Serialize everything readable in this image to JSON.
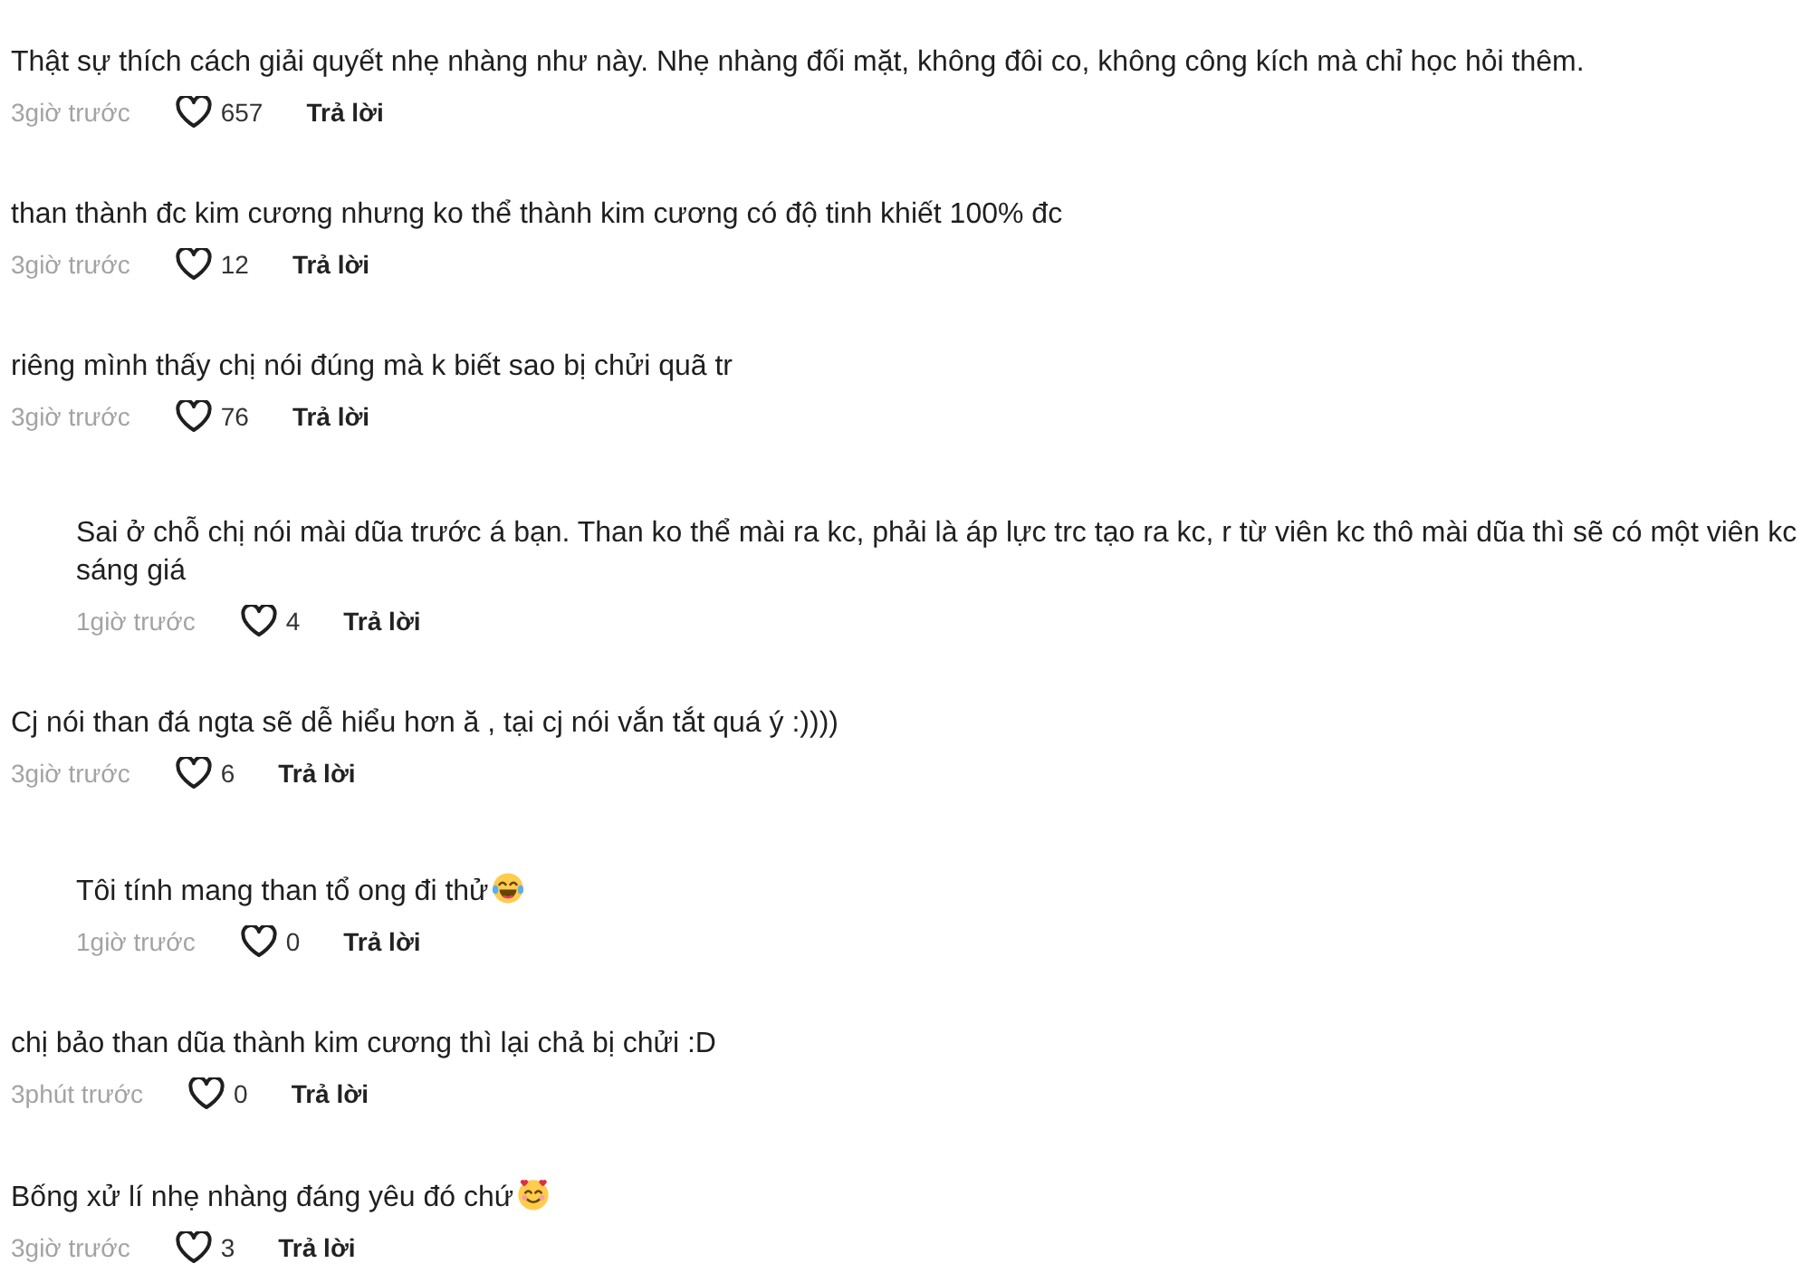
{
  "comments": [
    {
      "text": "Thật sự thích cách giải quyết nhẹ nhàng như này. Nhẹ nhàng đối mặt, không đôi co, không công kích mà chỉ học hỏi thêm.",
      "time": "3giờ trước",
      "likes": "657",
      "liked": false,
      "reply_label": "Trả lời"
    },
    {
      "text": "than thành đc kim cương nhưng ko thể thành kim cương có độ tinh khiết 100% đc",
      "time": "3giờ trước",
      "likes": "12",
      "liked": false,
      "reply_label": "Trả lời"
    },
    {
      "text": "riêng mình thấy chị nói đúng mà k biết sao bị chửi quã tr",
      "time": "3giờ trước",
      "likes": "76",
      "liked": false,
      "reply_label": "Trả lời",
      "replies": [
        {
          "text": "Sai ở chỗ chị nói mài dũa trước á bạn. Than ko thể mài ra kc, phải là áp lực trc tạo ra kc, r từ viên kc thô mài dũa thì sẽ có một viên kc sáng giá",
          "time": "1giờ trước",
          "likes": "4",
          "liked": false,
          "reply_label": "Trả lời"
        }
      ]
    },
    {
      "text": "Cj nói than đá ngta sẽ dễ hiểu hơn ă , tại cj nói vắn tắt quá ý :))))",
      "time": "3giờ trước",
      "likes": "6",
      "liked": false,
      "reply_label": "Trả lời",
      "replies": [
        {
          "text": "Tôi tính mang than tổ ong đi thử",
          "emoji": {
            "kind": "laughing"
          },
          "time": "1giờ trước",
          "likes": "0",
          "liked": false,
          "reply_label": "Trả lời"
        }
      ]
    },
    {
      "text": "chị bảo than dũa thành kim cương thì lại chả bị chửi :D",
      "time": "3phút trước",
      "likes": "0",
      "liked": false,
      "reply_label": "Trả lời"
    },
    {
      "text": "Bống xử lí nhẹ nhàng đáng yêu đó chứ",
      "emoji": {
        "kind": "hearts"
      },
      "time": "3giờ trước",
      "likes": "3",
      "liked": false,
      "reply_label": "Trả lời"
    }
  ]
}
